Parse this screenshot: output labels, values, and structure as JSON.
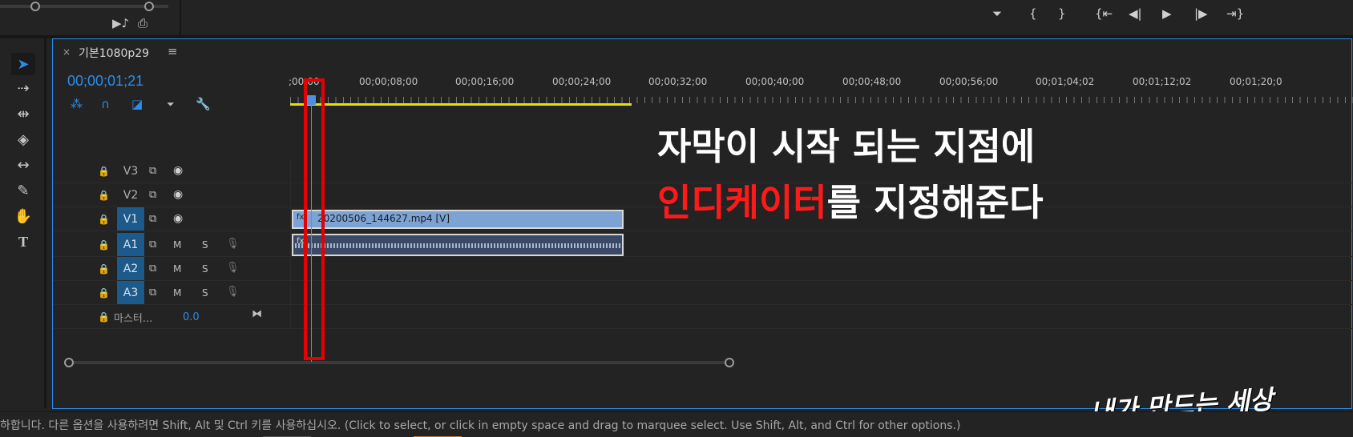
{
  "top_left": {
    "icon1": "music-to-sequence-icon",
    "icon2": "insert-icon"
  },
  "transport": {
    "marker": "⏷",
    "in_point": "{",
    "out_point": "}",
    "go_in": "{⇤",
    "step_back": "◀|",
    "play": "▶",
    "step_forward": "|▶",
    "go_out": "⇥}"
  },
  "tools": [
    "selection-tool",
    "track-select-tool",
    "ripple-edit-tool",
    "razor-tool",
    "slip-tool",
    "pen-tool",
    "hand-tool",
    "type-tool"
  ],
  "sequence": {
    "close": "×",
    "title": "기본1080p29",
    "menu": "≡",
    "timecode": "00;00;01;21"
  },
  "ruler": {
    "labels": [
      ";00;00",
      "00;00;08;00",
      "00;00;16;00",
      "00;00;24;00",
      "00;00;32;00",
      "00;00;40;00",
      "00;00;48;00",
      "00;00;56;00",
      "00;01;04;02",
      "00;01;12;02",
      "00;01;20;0"
    ]
  },
  "tracks": {
    "v3": "V3",
    "v2": "V2",
    "v1": "V1",
    "a1": "A1",
    "a2": "A2",
    "a3": "A3",
    "mute": "M",
    "solo": "S",
    "master_label": "마스터...",
    "master_value": "0.0"
  },
  "clips": {
    "video_name": "20200506_144627.mp4 [V]",
    "fx_label": "fx"
  },
  "annotation": {
    "line1": "자막이 시작 되는 지점에",
    "line2_red": "인디케이터",
    "line2_rest": "를 지정해준다"
  },
  "watermark": "내가 만드는 세상",
  "status": "하합니다. 다른 옵션을 사용하려면 Shift, Alt 및 Ctrl 키를 사용하십시오. (Click to select, or click in empty space and drag to marquee select. Use Shift, Alt, and Ctrl for other options.)",
  "colors": {
    "accent": "#2d8ceb",
    "annotation_red": "#ff1a1a",
    "highlight_box": "#e60000",
    "work_area": "#e6e000"
  }
}
